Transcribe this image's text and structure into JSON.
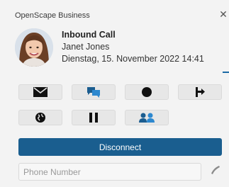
{
  "window": {
    "title": "OpenScape Business",
    "close_symbol": "✕"
  },
  "call": {
    "type": "Inbound Call",
    "caller": "Janet Jones",
    "datetime": "Dienstag, 15. November 2022 14:41"
  },
  "actions": {
    "row1": [
      "mail-icon",
      "chat-icon",
      "record-icon",
      "transfer-icon"
    ],
    "row2": [
      "globe-icon",
      "pause-icon",
      "conference-icon"
    ]
  },
  "disconnect": {
    "label": "Disconnect"
  },
  "dial": {
    "placeholder": "Phone Number",
    "value": ""
  },
  "colors": {
    "accent": "#1a5e8f",
    "background": "#f3f3f3",
    "button": "#e7e7e7"
  }
}
